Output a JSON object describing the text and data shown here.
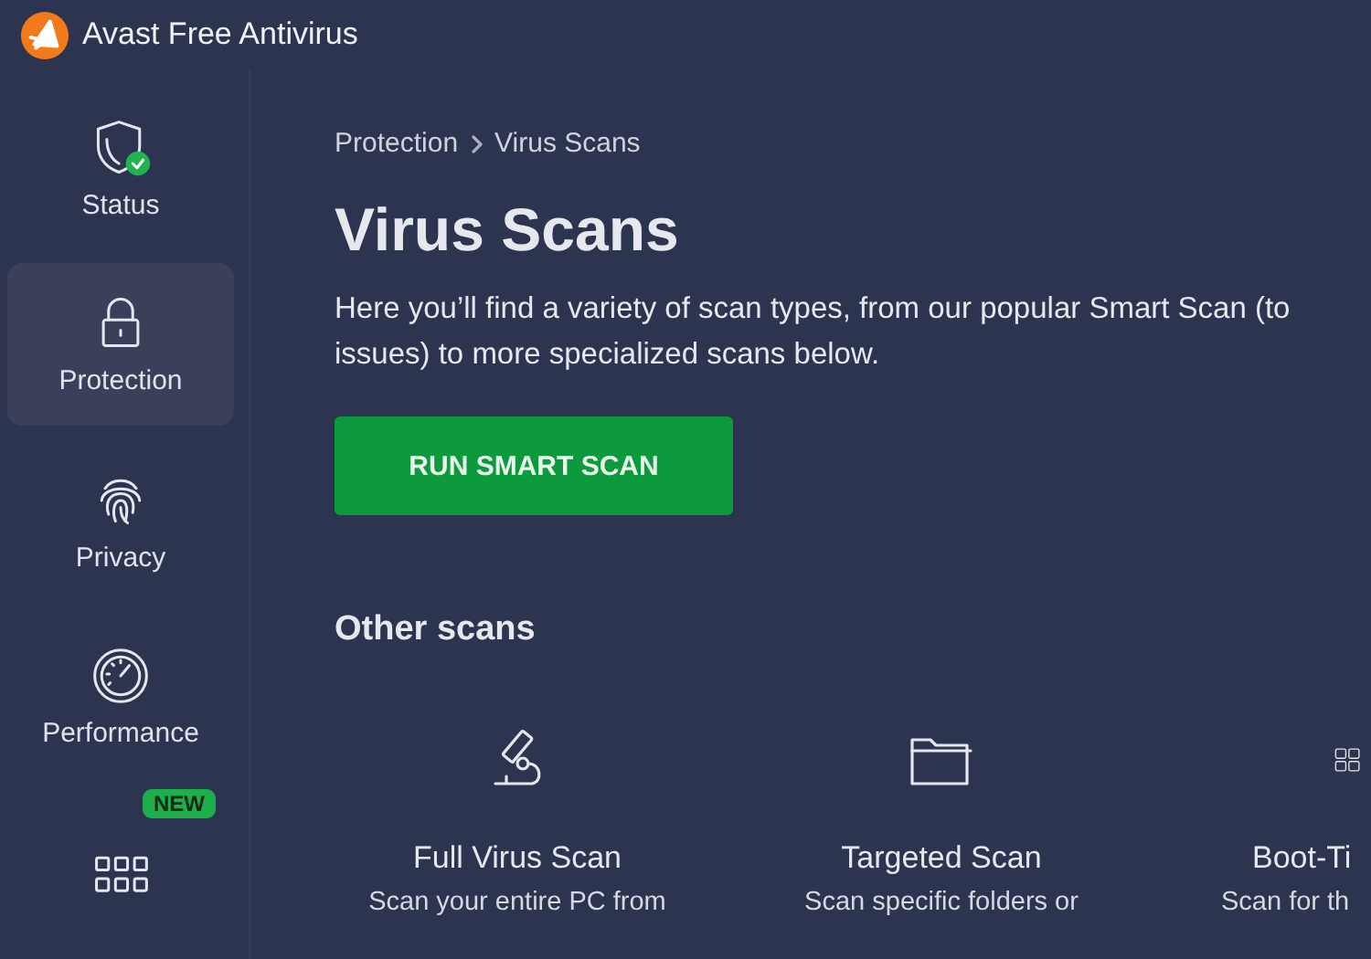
{
  "window": {
    "title": "Avast Free Antivirus"
  },
  "sidebar": {
    "items": [
      {
        "label": "Status",
        "selected": false,
        "ok": true
      },
      {
        "label": "Protection",
        "selected": true
      },
      {
        "label": "Privacy",
        "selected": false
      },
      {
        "label": "Performance",
        "selected": false
      },
      {
        "badge": "NEW",
        "selected": false
      }
    ]
  },
  "breadcrumb": [
    "Protection",
    "Virus Scans"
  ],
  "heading": "Virus Scans",
  "intro_lines": [
    "Here you’ll find a variety of scan types, from our popular Smart Scan (to",
    "issues) to more specialized scans below."
  ],
  "primary_button": "RUN SMART SCAN",
  "section_title": "Other scans",
  "scans": [
    {
      "title": "Full Virus Scan",
      "description": "Scan your entire PC from"
    },
    {
      "title": "Targeted Scan",
      "description": "Scan specific folders or"
    },
    {
      "title": "Boot-Ti",
      "description": "Scan for th"
    }
  ]
}
